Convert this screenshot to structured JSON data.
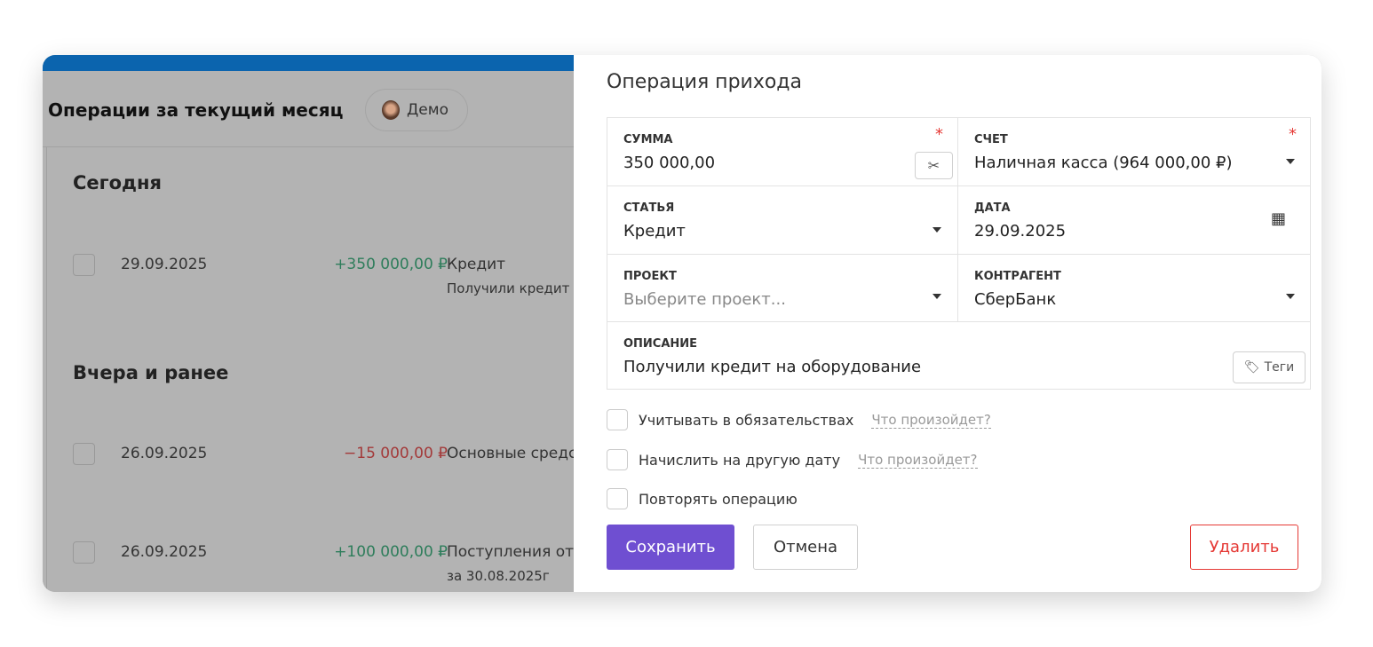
{
  "background": {
    "title": "Операции за текущий месяц",
    "demo_label": "Демо",
    "sections": [
      {
        "heading": "Сегодня"
      },
      {
        "heading": "Вчера и ранее"
      }
    ],
    "rows": [
      {
        "date": "29.09.2025",
        "amount": "+350 000,00 ₽",
        "category": "Кредит",
        "note": "Получили кредит"
      },
      {
        "date": "26.09.2025",
        "amount": "−15 000,00 ₽",
        "category": "Основные средс",
        "note": ""
      },
      {
        "date": "26.09.2025",
        "amount": "+100 000,00 ₽",
        "category": "Поступления от",
        "note": "за 30.08.2025г"
      }
    ]
  },
  "dialog": {
    "title": "Операция прихода",
    "fields": {
      "sum": {
        "label": "СУММА",
        "value": "350 000,00",
        "required": "*"
      },
      "account": {
        "label": "СЧЕТ",
        "value": "Наличная касса (964 000,00 ₽)",
        "required": "*"
      },
      "article": {
        "label": "СТАТЬЯ",
        "value": "Кредит"
      },
      "date": {
        "label": "ДАТА",
        "value": "29.09.2025"
      },
      "project": {
        "label": "ПРОЕКТ",
        "placeholder": "Выберите проект..."
      },
      "counterparty": {
        "label": "КОНТРАГЕНТ",
        "value": "СберБанк"
      },
      "description": {
        "label": "ОПИСАНИЕ",
        "value": "Получили кредит на оборудование"
      }
    },
    "tags_label": "Теги",
    "checkboxes": [
      {
        "label": "Учитывать в обязательствах",
        "help": "Что произойдет?"
      },
      {
        "label": "Начислить на другую дату",
        "help": "Что произойдет?"
      },
      {
        "label": "Повторять операцию"
      }
    ],
    "buttons": {
      "save": "Сохранить",
      "cancel": "Отмена",
      "delete": "Удалить"
    }
  },
  "colors": {
    "primary": "#6f4fd1",
    "danger": "#e53935",
    "income": "#2e7d5b",
    "expense": "#a33a3a"
  }
}
